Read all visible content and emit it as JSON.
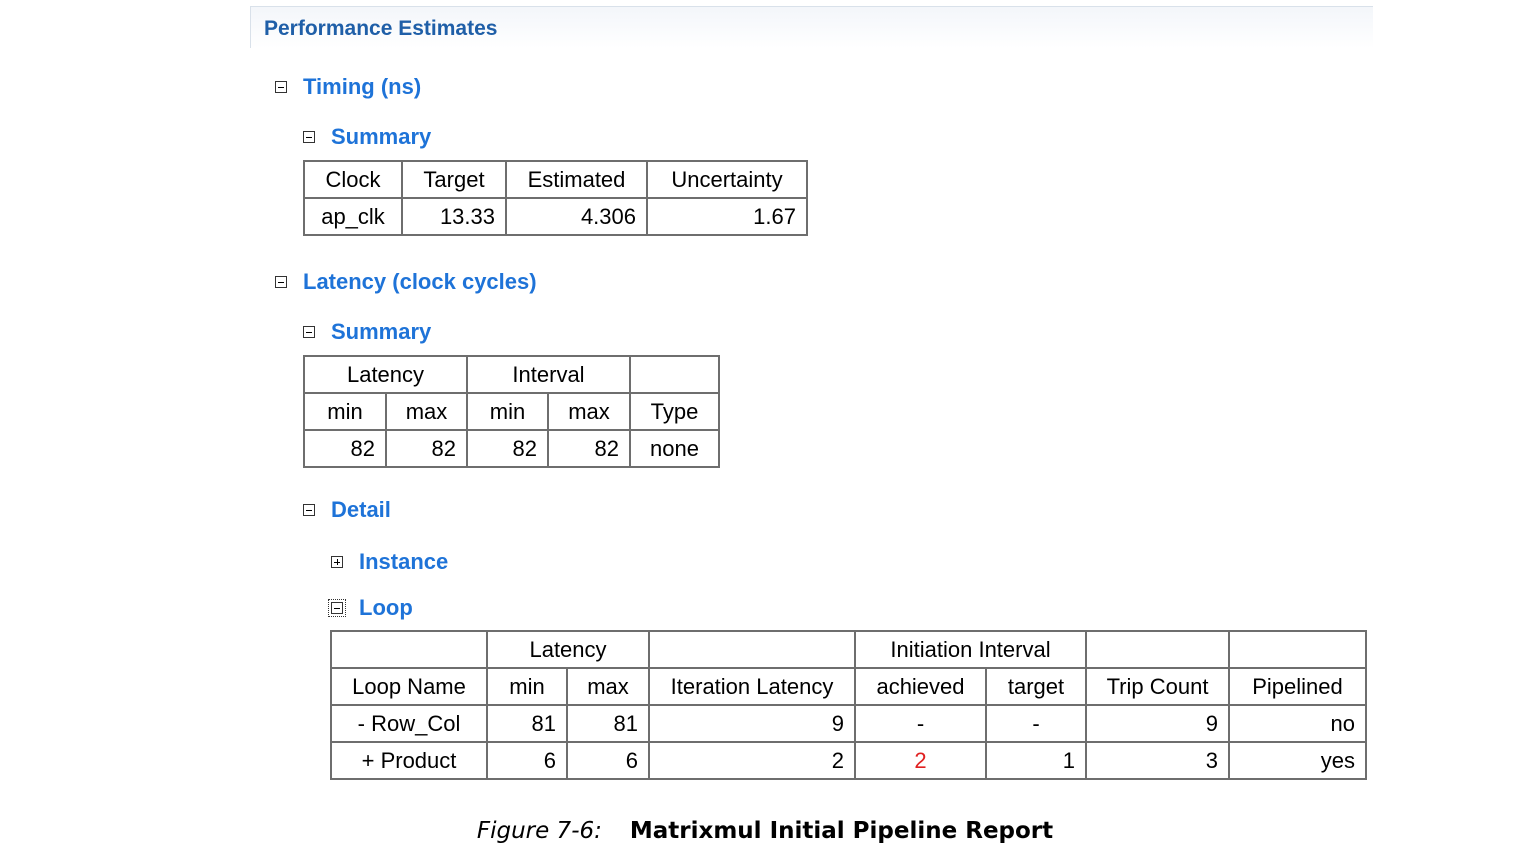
{
  "panel_title": "Performance Estimates",
  "timing": {
    "label": "Timing (ns)",
    "summary_label": "Summary",
    "headers": [
      "Clock",
      "Target",
      "Estimated",
      "Uncertainty"
    ],
    "row": [
      "ap_clk",
      "13.33",
      "4.306",
      "1.67"
    ]
  },
  "latency": {
    "label": "Latency (clock cycles)",
    "summary_label": "Summary",
    "group_headers": [
      "Latency",
      "Interval",
      ""
    ],
    "sub_headers": [
      "min",
      "max",
      "min",
      "max",
      "Type"
    ],
    "row": [
      "82",
      "82",
      "82",
      "82",
      "none"
    ],
    "detail_label": "Detail",
    "instance_label": "Instance",
    "loop_label": "Loop",
    "loop_table": {
      "group_headers": [
        "",
        "Latency",
        "",
        "Initiation Interval",
        "",
        ""
      ],
      "sub_headers": [
        "Loop Name",
        "min",
        "max",
        "Iteration Latency",
        "achieved",
        "target",
        "Trip Count",
        "Pipelined"
      ],
      "rows": [
        [
          "- Row_Col",
          "81",
          "81",
          "9",
          "-",
          "-",
          "9",
          "no"
        ],
        [
          "+ Product",
          "6",
          "6",
          "2",
          "2",
          "1",
          "3",
          "yes"
        ]
      ],
      "highlight_color": "#e02020"
    }
  },
  "caption": {
    "figure": "Figure 7-6:",
    "title": "Matrixmul Initial Pipeline Report"
  }
}
